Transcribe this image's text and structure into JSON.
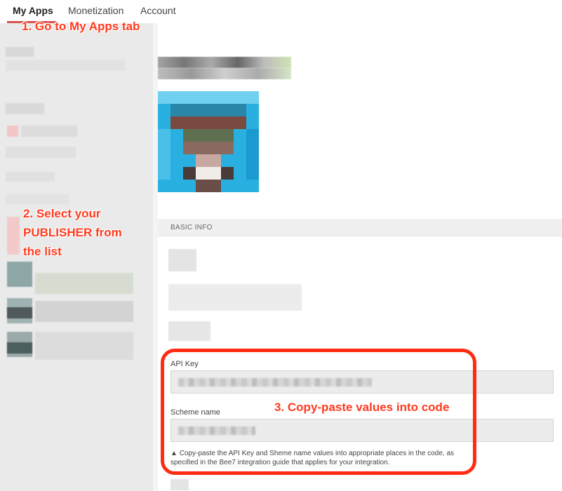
{
  "nav": {
    "tabs": [
      {
        "label": "My Apps"
      },
      {
        "label": "Monetization"
      },
      {
        "label": "Account"
      }
    ]
  },
  "annotations": {
    "step1": "1. Go to My Apps tab",
    "step2": "2.  Select your PUBLISHER from the list",
    "step3": "3. Copy-paste values into code"
  },
  "basic_info": {
    "title": "BASIC INFO",
    "api_key_label": "API Key",
    "api_key_value": "",
    "scheme_label": "Scheme name",
    "scheme_value": "",
    "note": "Copy-paste the API Key and Sheme name values into appropriate places in the code, as specified in the Bee7 integration guide that applies for your integration."
  },
  "icons": {
    "warning": "warning-icon"
  },
  "colors": {
    "annotation": "#ff3a1f",
    "highlight_box": "#ff2c14",
    "active_tab_underline": "#d9534f"
  }
}
